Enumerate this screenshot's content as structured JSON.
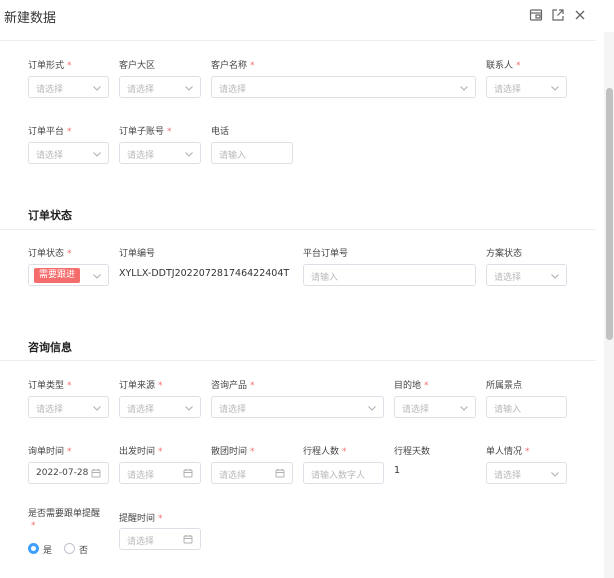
{
  "dialog": {
    "title": "新建数据"
  },
  "sections": {
    "status_title": "订单状态",
    "consult_title": "咨询信息"
  },
  "placeholders": {
    "select": "请选择",
    "input": "请输入",
    "input_number": "请输入数字人"
  },
  "labels": {
    "order_form": "订单形式",
    "customer_region": "客户大区",
    "customer_name": "客户名称",
    "contact": "联系人",
    "order_platform": "订单平台",
    "order_sub_account": "订单子账号",
    "phone": "电话",
    "order_status": "订单状态",
    "order_no": "订单编号",
    "platform_order_no": "平台订单号",
    "plan_status": "方案状态",
    "order_type": "订单类型",
    "order_source": "订单来源",
    "consult_product": "咨询产品",
    "destination": "目的地",
    "scenic_spot": "所属景点",
    "inquiry_time": "询单时间",
    "departure_time": "出发时间",
    "dismiss_time": "散团时间",
    "travelers": "行程人数",
    "trip_days": "行程天数",
    "single_situation": "单人情况",
    "remind_need": "是否需要跟单提醒",
    "remind_time": "提醒时间"
  },
  "values": {
    "order_status_badge": "需要跟进",
    "order_no": "XYLLX-DDTJ202207281746422404T",
    "inquiry_date": "2022-07-28",
    "trip_days": "1"
  },
  "remind_options": {
    "yes": "是",
    "no": "否",
    "selected": "是"
  },
  "colors": {
    "required_mark": "#f56c6c",
    "badge_bg": "#f56c6c",
    "radio_active": "#409eff"
  },
  "icons": {
    "header": [
      "fullscreen-icon",
      "popout-icon",
      "close-icon"
    ],
    "select": "chevron-down-icon",
    "date": "calendar-icon"
  }
}
